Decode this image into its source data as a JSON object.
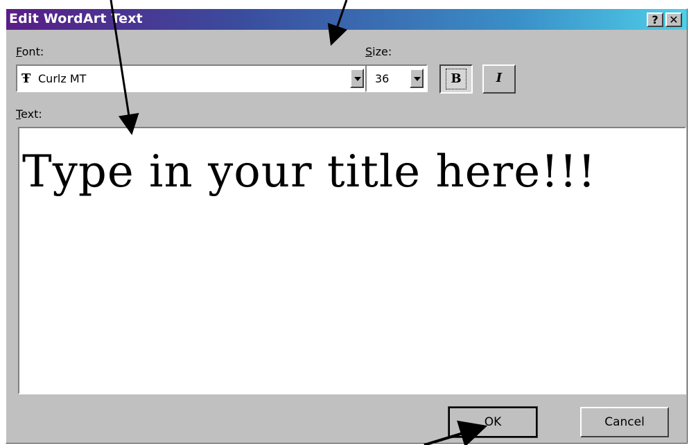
{
  "dialog": {
    "title": "Edit WordArt Text",
    "help_label": "?",
    "close_label": "✕"
  },
  "font": {
    "label_mnemonic": "F",
    "label_rest": "ont:",
    "icon": "truetype-font-icon",
    "value": "Curlz MT"
  },
  "size": {
    "label_mnemonic": "S",
    "label_rest": "ize:",
    "value": "36"
  },
  "format": {
    "bold_label": "B",
    "italic_label": "I",
    "bold_active": true
  },
  "text": {
    "label_mnemonic": "T",
    "label_rest": "ext:",
    "value": "Type in your title here!!!"
  },
  "buttons": {
    "ok_label": "OK",
    "cancel_label": "Cancel"
  },
  "colors": {
    "titlebar_start": "#5a1d86",
    "titlebar_end": "#4fcfe8",
    "dialog_bg": "#c0c0c0"
  }
}
